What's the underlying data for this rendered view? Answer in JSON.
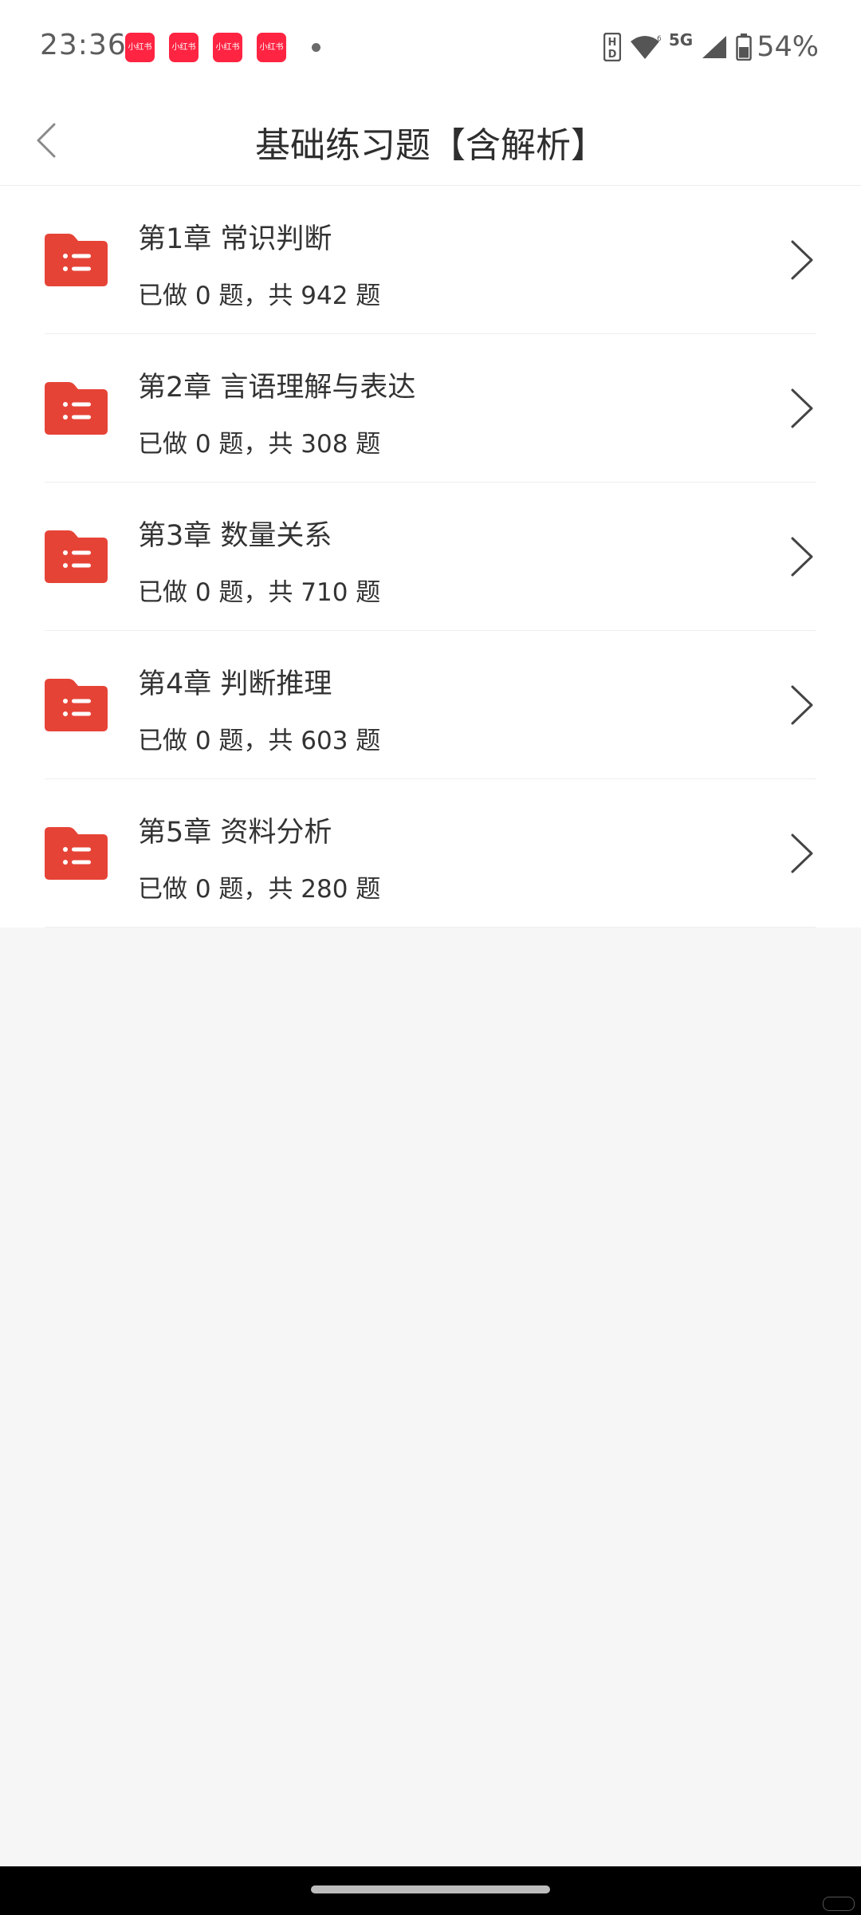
{
  "status_bar": {
    "time": "23:36",
    "notification_apps": [
      "小红书",
      "小红书",
      "小红书",
      "小红书"
    ],
    "network": "5G",
    "battery": "54%"
  },
  "header": {
    "title": "基础练习题【含解析】"
  },
  "chapters": [
    {
      "title": "第1章 常识判断",
      "progress": "已做 0 题，共 942 题"
    },
    {
      "title": "第2章 言语理解与表达",
      "progress": "已做 0 题，共 308 题"
    },
    {
      "title": "第3章 数量关系",
      "progress": "已做 0 题，共 710 题"
    },
    {
      "title": "第4章 判断推理",
      "progress": "已做 0 题，共 603 题"
    },
    {
      "title": "第5章 资料分析",
      "progress": "已做 0 题，共 280 题"
    }
  ],
  "colors": {
    "accent": "#e64337",
    "title_text": "#2e2e2e",
    "list_text": "#333333",
    "background": "#f6f6f6",
    "notification_badge": "#ff2442"
  },
  "icons": {
    "back": "chevron-left-icon",
    "chapter": "folder-list-icon",
    "item_arrow": "chevron-right-icon"
  }
}
